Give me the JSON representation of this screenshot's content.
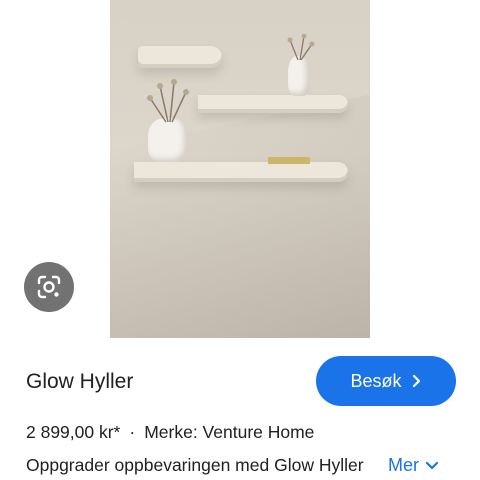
{
  "product": {
    "title": "Glow Hyller",
    "price": "2 899,00 kr*",
    "separator": "·",
    "brand": "Merke: Venture Home",
    "description": "Oppgrader oppbevaringen med Glow Hyller",
    "more_label": "Mer"
  },
  "actions": {
    "visit_label": "Besøk",
    "accent_color": "#1a73e8"
  },
  "icons": {
    "lens": "google-lens-icon",
    "visit_chevron": "chevron-right-icon",
    "more_chevron": "chevron-down-icon"
  }
}
